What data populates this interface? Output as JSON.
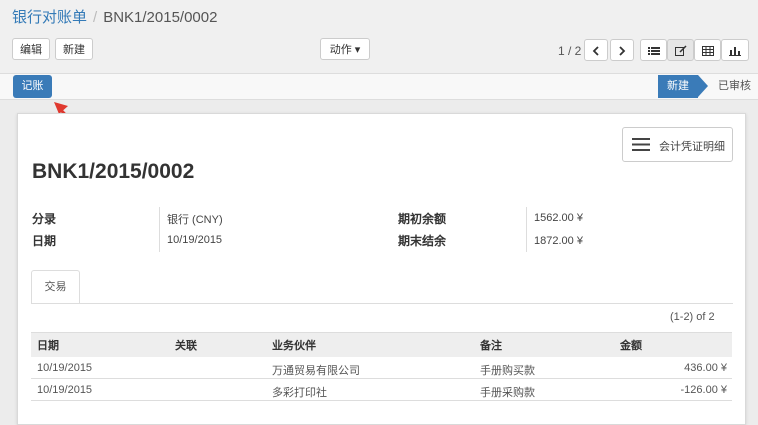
{
  "breadcrumb": {
    "parent": "银行对账单",
    "separator": "/",
    "current": "BNK1/2015/0002"
  },
  "toolbar": {
    "edit": "编辑",
    "create": "新建",
    "action": "动作 ▾"
  },
  "pager": {
    "text": "1 / 2"
  },
  "status": {
    "post_button": "记账",
    "stage_new": "新建",
    "stage_validated": "已审核"
  },
  "smart_button": {
    "label": "会计凭证明细"
  },
  "record": {
    "title": "BNK1/2015/0002",
    "journal_label": "分录",
    "journal_value": "银行 (CNY)",
    "date_label": "日期",
    "date_value": "10/19/2015",
    "start_balance_label": "期初余额",
    "start_balance_value": "1562.00 ¥",
    "end_balance_label": "期末结余",
    "end_balance_value": "1872.00 ¥"
  },
  "tab": {
    "label": "交易"
  },
  "lines": {
    "count": "(1-2) of 2",
    "headers": {
      "date": "日期",
      "ref": "关联",
      "partner": "业务伙伴",
      "memo": "备注",
      "amount": "金额"
    },
    "rows": [
      {
        "date": "10/19/2015",
        "ref": "",
        "partner": "万通贸易有限公司",
        "memo": "手册购买款",
        "amount": "436.00 ¥"
      },
      {
        "date": "10/19/2015",
        "ref": "",
        "partner": "多彩打印社",
        "memo": "手册采购款",
        "amount": "-126.00 ¥"
      }
    ]
  },
  "colors": {
    "primary": "#3a7bb8",
    "annotation_arrow": "#e0392f"
  }
}
